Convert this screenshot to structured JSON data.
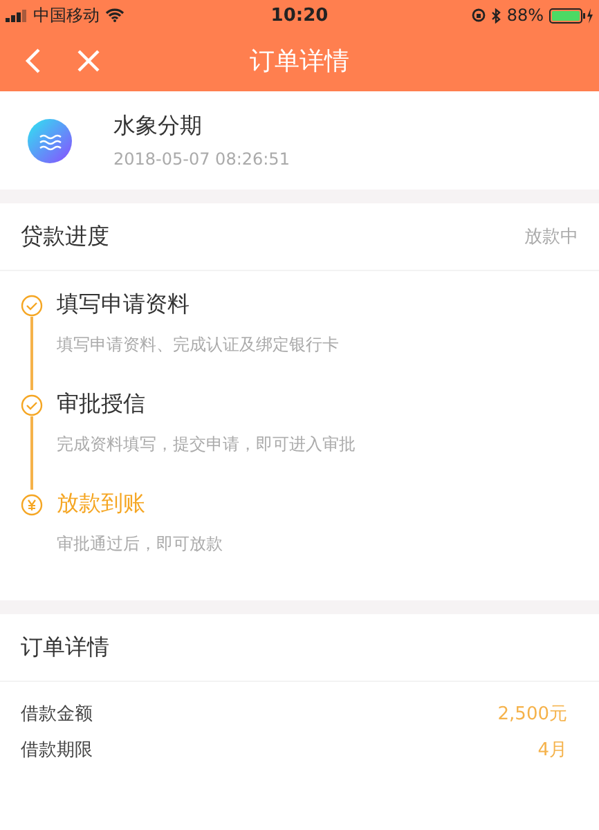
{
  "status_bar": {
    "carrier": "中国移动",
    "time": "10:20",
    "battery": "88%"
  },
  "nav": {
    "title": "订单详情"
  },
  "product": {
    "name": "水象分期",
    "datetime": "2018-05-07 08:26:51"
  },
  "progress": {
    "title": "贷款进度",
    "status": "放款中",
    "steps": [
      {
        "title": "填写申请资料",
        "desc": "填写申请资料、完成认证及绑定银行卡",
        "kind": "done"
      },
      {
        "title": "审批授信",
        "desc": "完成资料填写，提交申请，即可进入审批",
        "kind": "done"
      },
      {
        "title": "放款到账",
        "desc": "审批通过后，即可放款",
        "kind": "current"
      }
    ]
  },
  "details": {
    "title": "订单详情",
    "rows": [
      {
        "label": "借款金额",
        "value": "2,500元"
      },
      {
        "label": "借款期限",
        "value": "4月"
      }
    ]
  }
}
